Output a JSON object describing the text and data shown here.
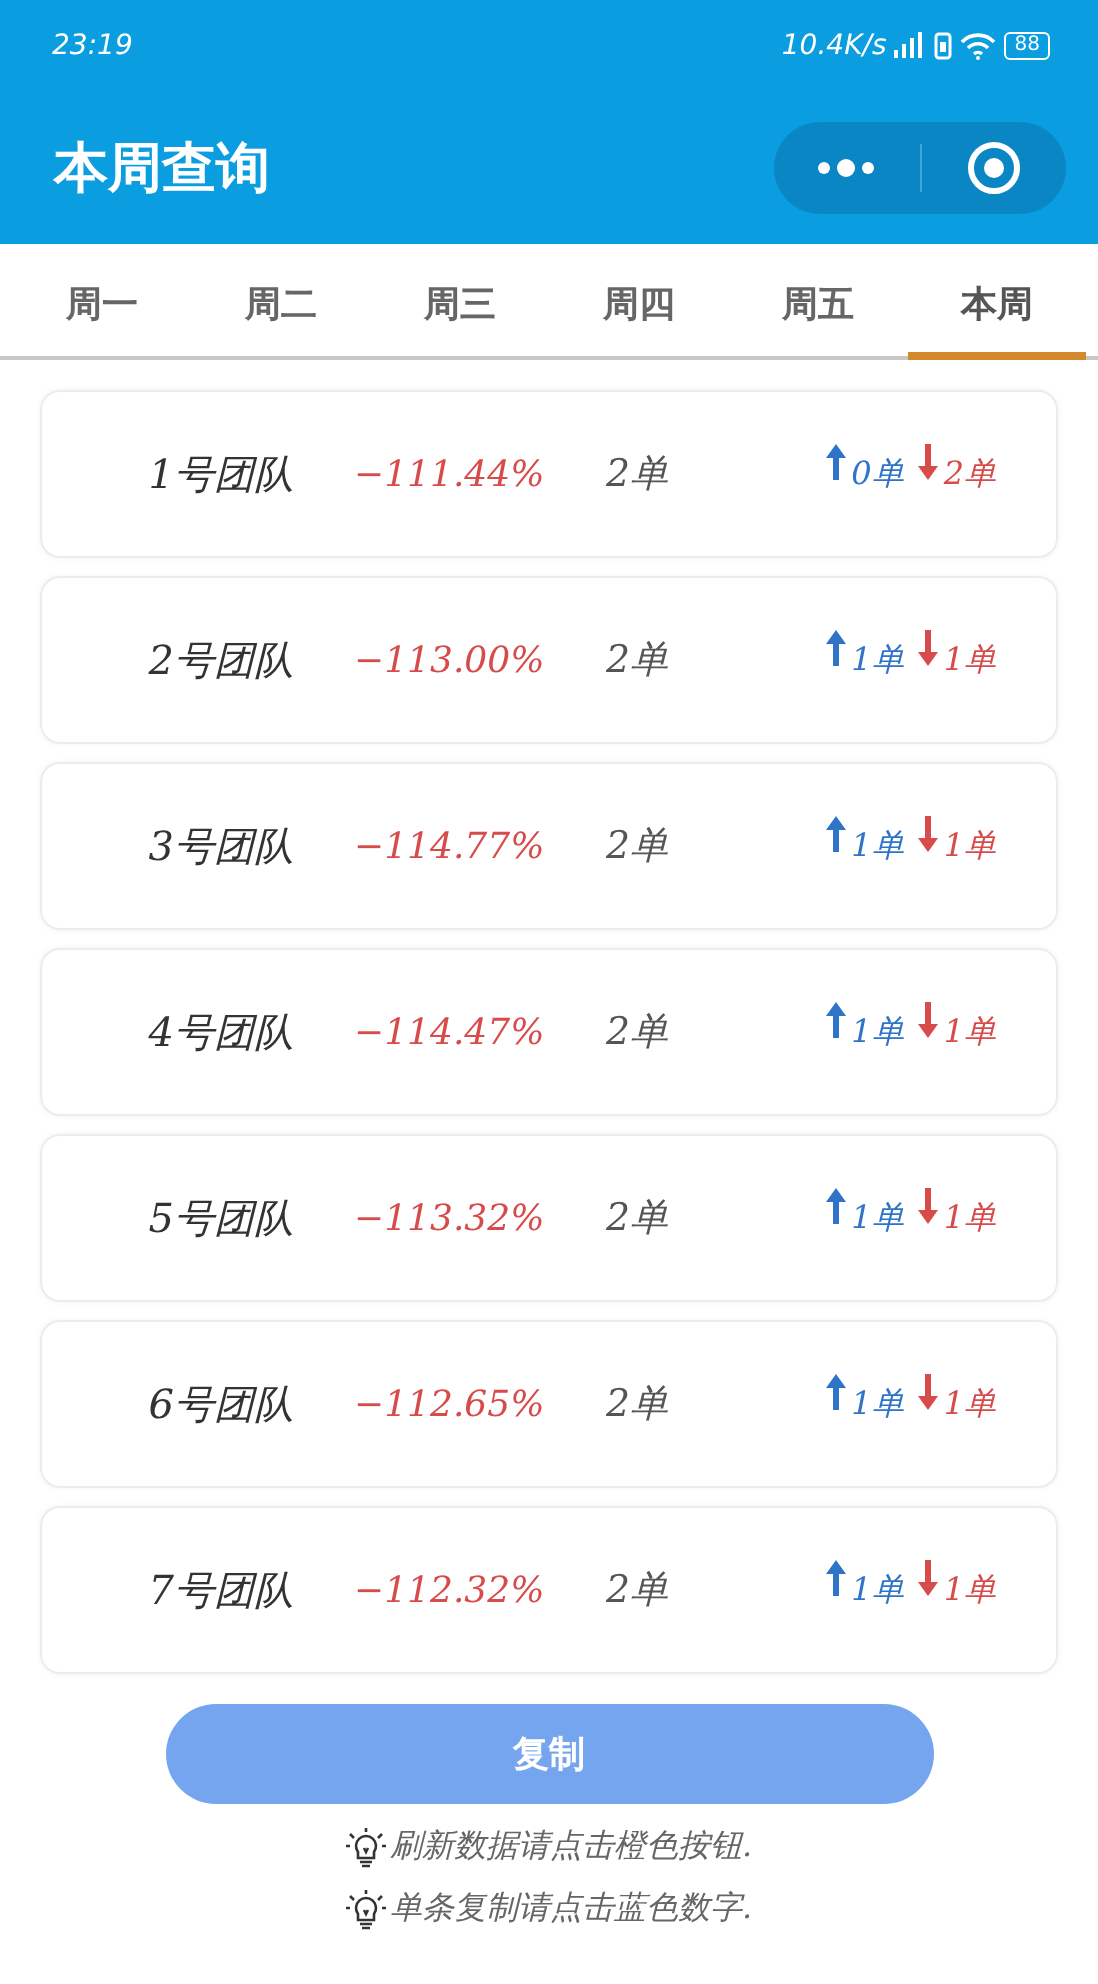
{
  "status_bar": {
    "time": "23:19",
    "speed": "10.4K/s",
    "battery": "88"
  },
  "header": {
    "title": "本周查询"
  },
  "tabs": [
    {
      "label": "周一",
      "selected": false
    },
    {
      "label": "周二",
      "selected": false
    },
    {
      "label": "周三",
      "selected": false
    },
    {
      "label": "周四",
      "selected": false
    },
    {
      "label": "周五",
      "selected": false
    },
    {
      "label": "本周",
      "selected": true
    }
  ],
  "teams": [
    {
      "name": "1号团队",
      "rate": "−111.44%",
      "orders": "2单",
      "up": "0单",
      "down": "2单"
    },
    {
      "name": "2号团队",
      "rate": "−113.00%",
      "orders": "2单",
      "up": "1单",
      "down": "1单"
    },
    {
      "name": "3号团队",
      "rate": "−114.77%",
      "orders": "2单",
      "up": "1单",
      "down": "1单"
    },
    {
      "name": "4号团队",
      "rate": "−114.47%",
      "orders": "2单",
      "up": "1单",
      "down": "1单"
    },
    {
      "name": "5号团队",
      "rate": "−113.32%",
      "orders": "2单",
      "up": "1单",
      "down": "1单"
    },
    {
      "name": "6号团队",
      "rate": "−112.65%",
      "orders": "2单",
      "up": "1单",
      "down": "1单"
    },
    {
      "name": "7号团队",
      "rate": "−112.32%",
      "orders": "2单",
      "up": "1单",
      "down": "1单"
    }
  ],
  "copy_button": "复制",
  "hints": [
    "刷新数据请点击橙色按钮.",
    "单条复制请点击蓝色数字."
  ]
}
